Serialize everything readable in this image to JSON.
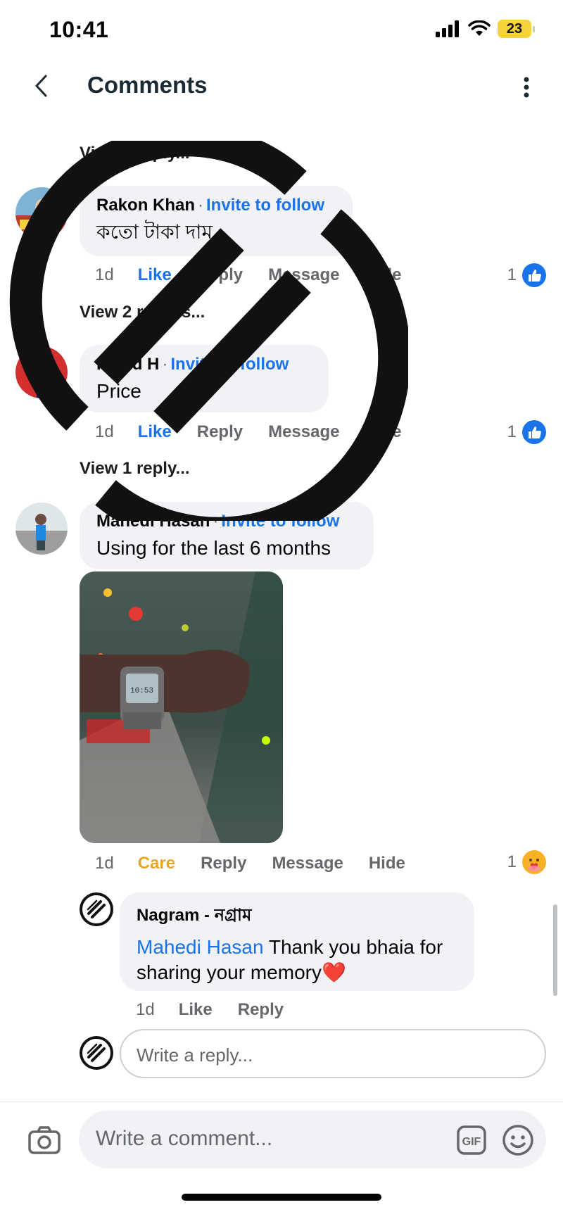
{
  "status_bar": {
    "time": "10:41",
    "battery": "23"
  },
  "header": {
    "title": "Comments"
  },
  "comments": [
    {
      "view_replies": "View 1 reply...",
      "author": "Rakon Khan",
      "invite": "Invite to follow",
      "text": "কতো টাকা দাম",
      "time": "1d",
      "actions": [
        "Like",
        "Reply",
        "Message",
        "Hide"
      ],
      "reaction_count": "1"
    },
    {
      "view_replies": "View 2 replies...",
      "author": "Rakid H",
      "invite": "Invite to follow",
      "text": "Price",
      "time": "1d",
      "actions": [
        "Like",
        "Reply",
        "Message",
        "Hide"
      ],
      "reaction_count": "1"
    },
    {
      "view_replies": "View 1 reply...",
      "author": "Mahedi Hasan",
      "invite": "Invite to follow",
      "text": "Using for the last 6 months",
      "time": "1d",
      "actions": [
        "Care",
        "Reply",
        "Message",
        "Hide"
      ],
      "reaction_count": "1"
    }
  ],
  "reply": {
    "author": "Nagram - নগ্রাম",
    "mention": "Mahedi Hasan",
    "text": " Thank you bhaia for sharing your memory",
    "emoji": "❤️",
    "time": "1d",
    "actions": [
      "Like",
      "Reply"
    ]
  },
  "reply_input": {
    "placeholder": "Write a reply..."
  },
  "composer": {
    "placeholder": "Write a comment...",
    "gif_label": "GIF"
  },
  "colors": {
    "accent": "#1a73e8",
    "care": "#e8a624",
    "bubble": "#f0f2f5",
    "text_secondary": "#65676b"
  }
}
